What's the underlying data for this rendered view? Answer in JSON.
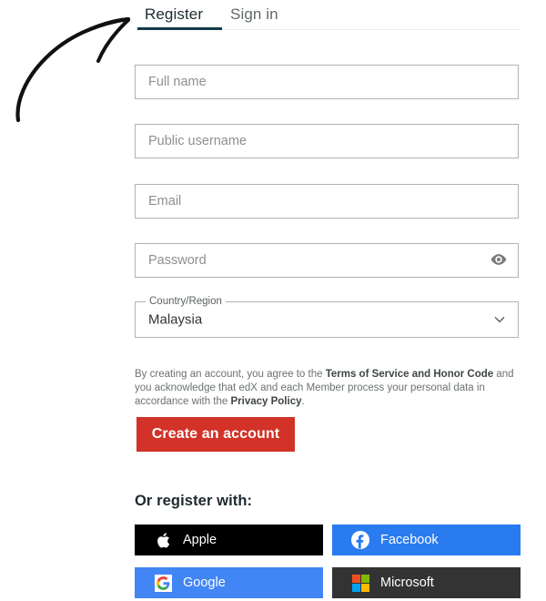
{
  "tabs": {
    "register": "Register",
    "signin": "Sign in",
    "active": "Register",
    "active_underline_color": "#123a48"
  },
  "form": {
    "fields": [
      {
        "name": "full-name",
        "placeholder": "Full name",
        "value": ""
      },
      {
        "name": "public-username",
        "placeholder": "Public username",
        "value": ""
      },
      {
        "name": "email",
        "placeholder": "Email",
        "value": ""
      },
      {
        "name": "password",
        "placeholder": "Password",
        "value": ""
      }
    ],
    "country": {
      "label": "Country/Region",
      "value": "Malaysia"
    }
  },
  "legal": {
    "part1": "By creating an account, you agree to the ",
    "link1": "Terms of Service and Honor Code",
    "part2": " and you acknowledge that edX and each Member process your personal data in accordance with the ",
    "link2": "Privacy Policy",
    "part3": "."
  },
  "primary_button": {
    "label": "Create an account",
    "color": "#d23228"
  },
  "social": {
    "title": "Or register with:",
    "buttons": [
      {
        "label": "Apple",
        "icon": "apple-icon",
        "bg": "#000000"
      },
      {
        "label": "Facebook",
        "icon": "facebook-icon",
        "bg": "#2a7bf0"
      },
      {
        "label": "Google",
        "icon": "google-icon",
        "bg": "#4285f4"
      },
      {
        "label": "Microsoft",
        "icon": "microsoft-icon",
        "bg": "#333333"
      }
    ]
  },
  "annotation": {
    "type": "hand-drawn-arrow",
    "points_to": "Register"
  }
}
